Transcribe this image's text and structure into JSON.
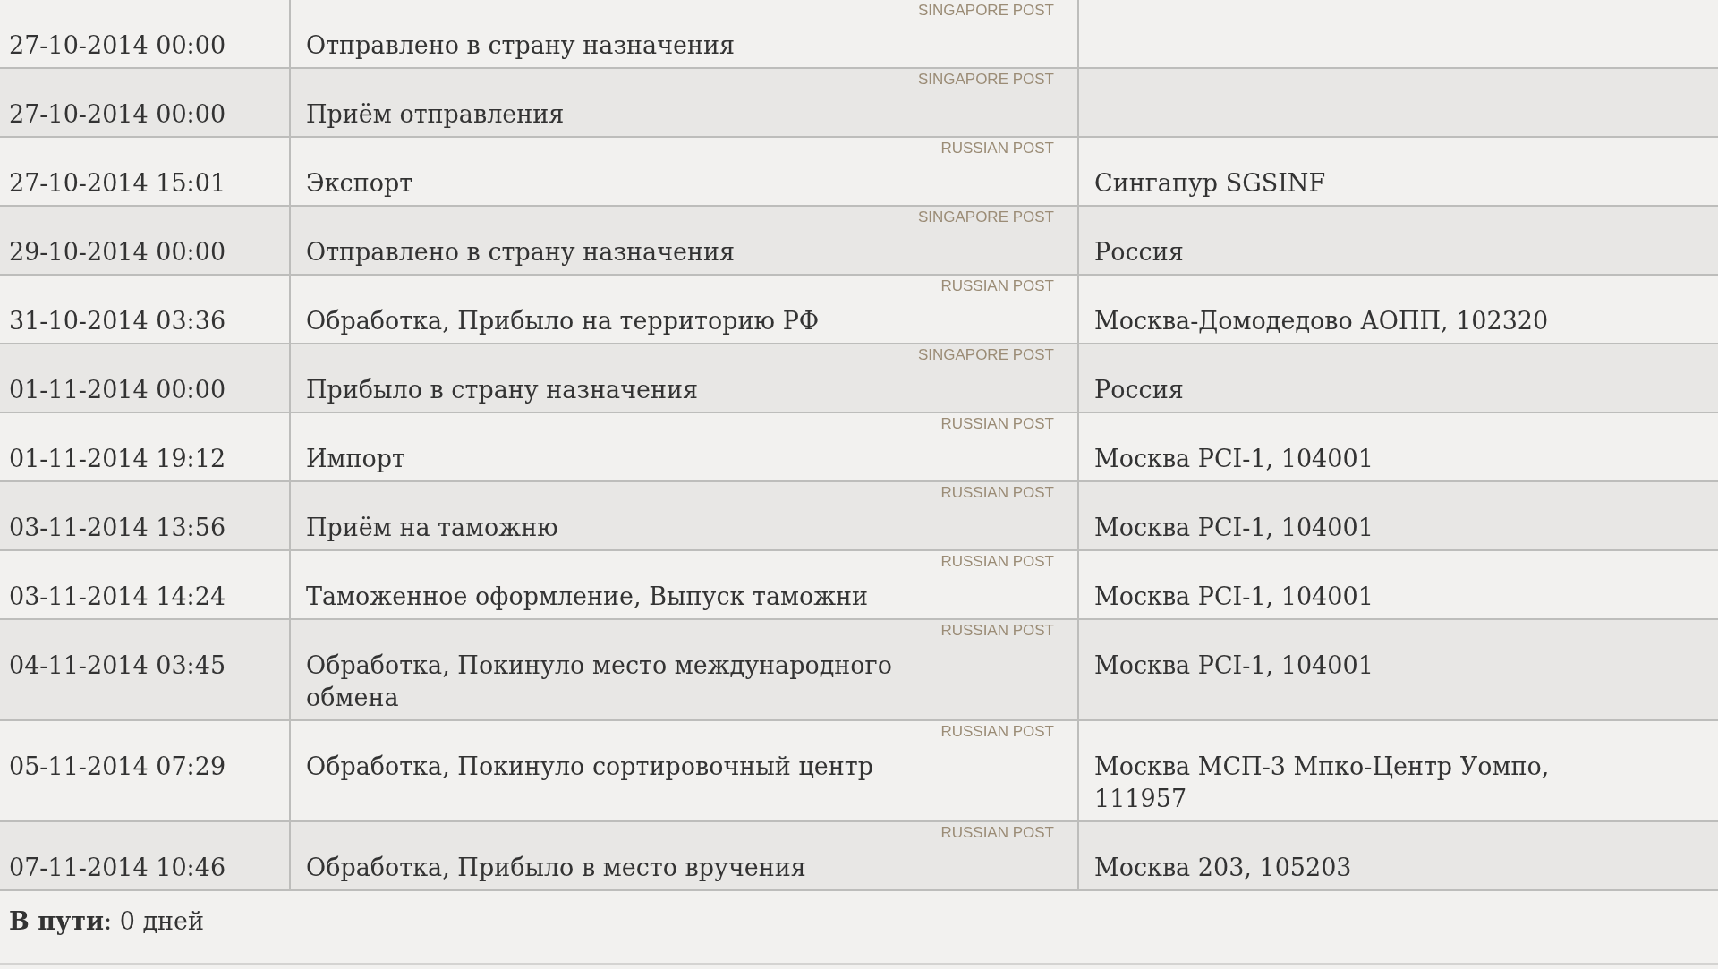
{
  "events": [
    {
      "date": "27-10-2014 00:00",
      "carrier": "SINGAPORE POST",
      "status": "Отправлено в страну назначения"
    },
    {
      "date": "27-10-2014 00:00",
      "carrier": "SINGAPORE POST",
      "status": "Приём отправления"
    },
    {
      "date": "27-10-2014 15:01",
      "carrier": "RUSSIAN POST",
      "status": "Экспорт",
      "location": "Сингапур SGSINF"
    },
    {
      "date": "29-10-2014 00:00",
      "carrier": "SINGAPORE POST",
      "status": "Отправлено в страну назначения",
      "location": "Россия"
    },
    {
      "date": "31-10-2014 03:36",
      "carrier": "RUSSIAN POST",
      "status": "Обработка, Прибыло на территорию РФ",
      "location": "Москва-Домодедово АОПП, 102320"
    },
    {
      "date": "01-11-2014 00:00",
      "carrier": "SINGAPORE POST",
      "status": "Прибыло в страну назначения",
      "location": "Россия"
    },
    {
      "date": "01-11-2014 19:12",
      "carrier": "RUSSIAN POST",
      "status": "Импорт",
      "location": "Москва PCI-1, 104001"
    },
    {
      "date": "03-11-2014 13:56",
      "carrier": "RUSSIAN POST",
      "status": "Приём на таможню",
      "location": "Москва PCI-1, 104001"
    },
    {
      "date": "03-11-2014 14:24",
      "carrier": "RUSSIAN POST",
      "status": "Таможенное оформление, Выпуск таможни",
      "location": "Москва PCI-1, 104001"
    },
    {
      "date": "04-11-2014 03:45",
      "carrier": "RUSSIAN POST",
      "status": "Обработка, Покинуло место международного обмена",
      "location": "Москва PCI-1, 104001"
    },
    {
      "date": "05-11-2014 07:29",
      "carrier": "RUSSIAN POST",
      "status": "Обработка, Покинуло сортировочный центр",
      "location": "Москва МСП-3 Мпко-Центр Уомпо, 111957"
    },
    {
      "date": "07-11-2014 10:46",
      "carrier": "RUSSIAN POST",
      "status": "Обработка, Прибыло в место вручения",
      "location": "Москва 203, 105203"
    }
  ],
  "transit": "**В пути**:  0 дней"
}
